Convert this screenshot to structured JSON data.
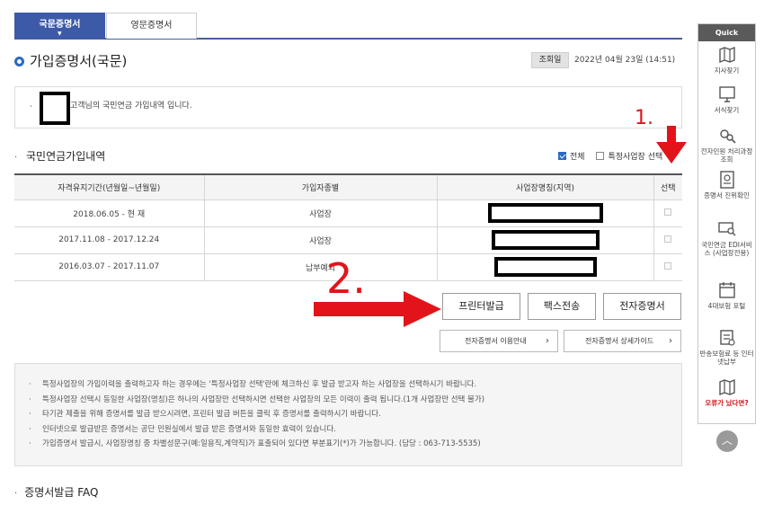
{
  "tabs": [
    {
      "label": "국문증명서",
      "active": true
    },
    {
      "label": "영문증명서",
      "active": false
    }
  ],
  "page": {
    "title": "가입증명서(국문)",
    "view_label": "조회일",
    "view_date": "2022년 04월 23일 (14:51)"
  },
  "notice": {
    "message": "고객님의 국민연금 가입내역 입니다."
  },
  "section": {
    "title": "국민연금가입내역",
    "filter_all": "전체",
    "filter_specific": "특정사업장 선택"
  },
  "table": {
    "headers": [
      "자격유지기간(년월일~년월일)",
      "가입자종별",
      "사업장명칭(지역)",
      "선택"
    ],
    "rows": [
      {
        "period": "2018.06.05 - 현 재",
        "type": "사업장"
      },
      {
        "period": "2017.11.08 - 2017.12.24",
        "type": "사업장"
      },
      {
        "period": "2016.03.07 - 2017.11.07",
        "type": "납부예외"
      }
    ]
  },
  "buttons": {
    "print": "프린터발급",
    "fax": "팩스전송",
    "edoc": "전자증명서",
    "guide_usage": "전자증명서 이용안내",
    "guide_detail": "전자증명서 상세가이드"
  },
  "info_lines": [
    "특정사업장의 가입이력을 출력하고자 하는 경우에는 '특정사업장 선택'란에 체크하신 후 발급 받고자 하는 사업장을 선택하시기 바랍니다.",
    "특정사업장 선택시 동일한 사업장(명칭)은 하나의 사업장만 선택하시면 선택한 사업장의 모든 이력이 출력 됩니다.(1개 사업장만 선택 불가)",
    "타기관 제출을 위해 증명서를 발급 받으시려면, 프린터 발급 버튼을 클릭 후 증명서를 출력하시기 바랍니다.",
    "인터넷으로 발급받은 증명서는 공단 민원실에서 발급 받은 증명서와 동일한 효력이 있습니다.",
    "가입증명서 발급시, 사업장명칭 중 차별성문구(예:일용직,계약직)가 표출되어 있다면 부분표기(*)가 가능합니다. (담당 : 063-713-5535)"
  ],
  "faq": {
    "title": "증명서발급 FAQ"
  },
  "quick": {
    "header": "Quick",
    "items": [
      {
        "label": "지사찾기",
        "icon": "map-icon"
      },
      {
        "label": "서식찾기",
        "icon": "monitor-icon"
      },
      {
        "label": "전자민원 처리과정 조회",
        "icon": "gear-search-icon"
      },
      {
        "label": "증명서 진위확인",
        "icon": "certificate-icon"
      },
      {
        "label": "국민연금 EDI서비스 (사업장전용)",
        "icon": "monitor-search-icon"
      },
      {
        "label": "4대보험 포털",
        "icon": "calendar-icon"
      },
      {
        "label": "반송보험료 등 인터넷납부",
        "icon": "receipt-icon"
      },
      {
        "label": "오류가 났다면?",
        "icon": "map-alert-icon"
      }
    ]
  },
  "annotations": {
    "mark1": "1.",
    "mark2": "2."
  },
  "colors": {
    "tab_active": "#3d5aa8",
    "bullet": "#2c69c4",
    "annotation_red": "#e2141a"
  }
}
